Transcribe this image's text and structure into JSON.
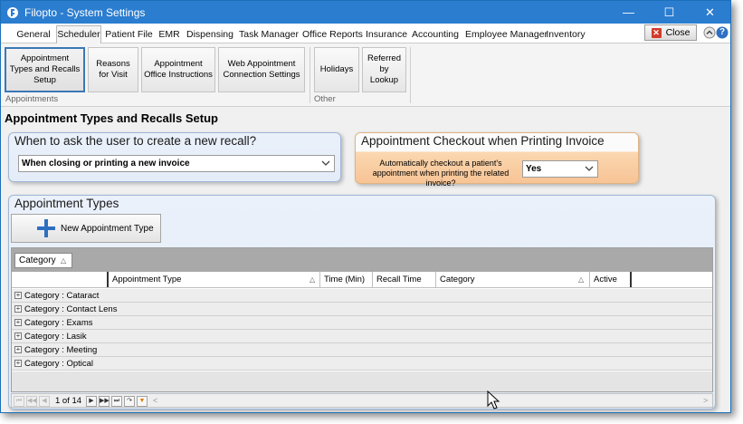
{
  "window": {
    "title": "Filopto - System Settings",
    "controls": {
      "minimize": "—",
      "maximize": "☐",
      "close": "✕"
    }
  },
  "menu": {
    "tabs": [
      {
        "label": "General"
      },
      {
        "label": "Scheduler",
        "active": true
      },
      {
        "label": "Patient File"
      },
      {
        "label": "EMR"
      },
      {
        "label": "Dispensing"
      },
      {
        "label": "Task Manager"
      },
      {
        "label": "Office Reports"
      },
      {
        "label": "Insurance"
      },
      {
        "label": "Accounting"
      },
      {
        "label": "Employee Manager"
      },
      {
        "label": "Inventory"
      }
    ],
    "close_label": "Close",
    "close_glyph": "✕",
    "help_glyph": "?"
  },
  "ribbon": {
    "buttons": [
      {
        "label": "Appointment Types and Recalls Setup",
        "selected": true
      },
      {
        "label": "Reasons for Visit"
      },
      {
        "label": "Appointment Office Instructions"
      },
      {
        "label": "Web Appointment Connection Settings"
      },
      {
        "label": "Holidays"
      },
      {
        "label": "Referred by Lookup"
      }
    ],
    "groups": {
      "appointments": "Appointments",
      "other": "Other"
    }
  },
  "page": {
    "title": "Appointment Types and Recalls Setup"
  },
  "recall_panel": {
    "title": "When to ask the user to create a new recall?",
    "selected": "When closing or printing a new invoice"
  },
  "checkout_panel": {
    "title": "Appointment Checkout when Printing Invoice",
    "label": "Automatically checkout a patient's appointment when printing the related invoice?",
    "selected": "Yes"
  },
  "types_panel": {
    "title": "Appointment Types",
    "new_button": "New Appointment Type",
    "group_chip": "Category",
    "sort_glyph": "△",
    "columns": [
      {
        "label": "Appointment Type"
      },
      {
        "label": "Time (Min)"
      },
      {
        "label": "Recall Time"
      },
      {
        "label": "Category"
      },
      {
        "label": "Active"
      }
    ],
    "groups": [
      "Category : Cataract",
      "Category : Contact Lens",
      "Category : Exams",
      "Category : Lasik",
      "Category : Meeting",
      "Category : Optical"
    ],
    "expander_glyph": "+",
    "pager": {
      "page_text": "1 of 14",
      "first": "⏮",
      "prev_page": "◀◀",
      "prev": "◀",
      "next": "▶",
      "next_page": "▶▶",
      "last": "⏭",
      "refresh": "↷",
      "filter": "▼",
      "scroll_left": "<",
      "scroll_right": ">"
    }
  }
}
